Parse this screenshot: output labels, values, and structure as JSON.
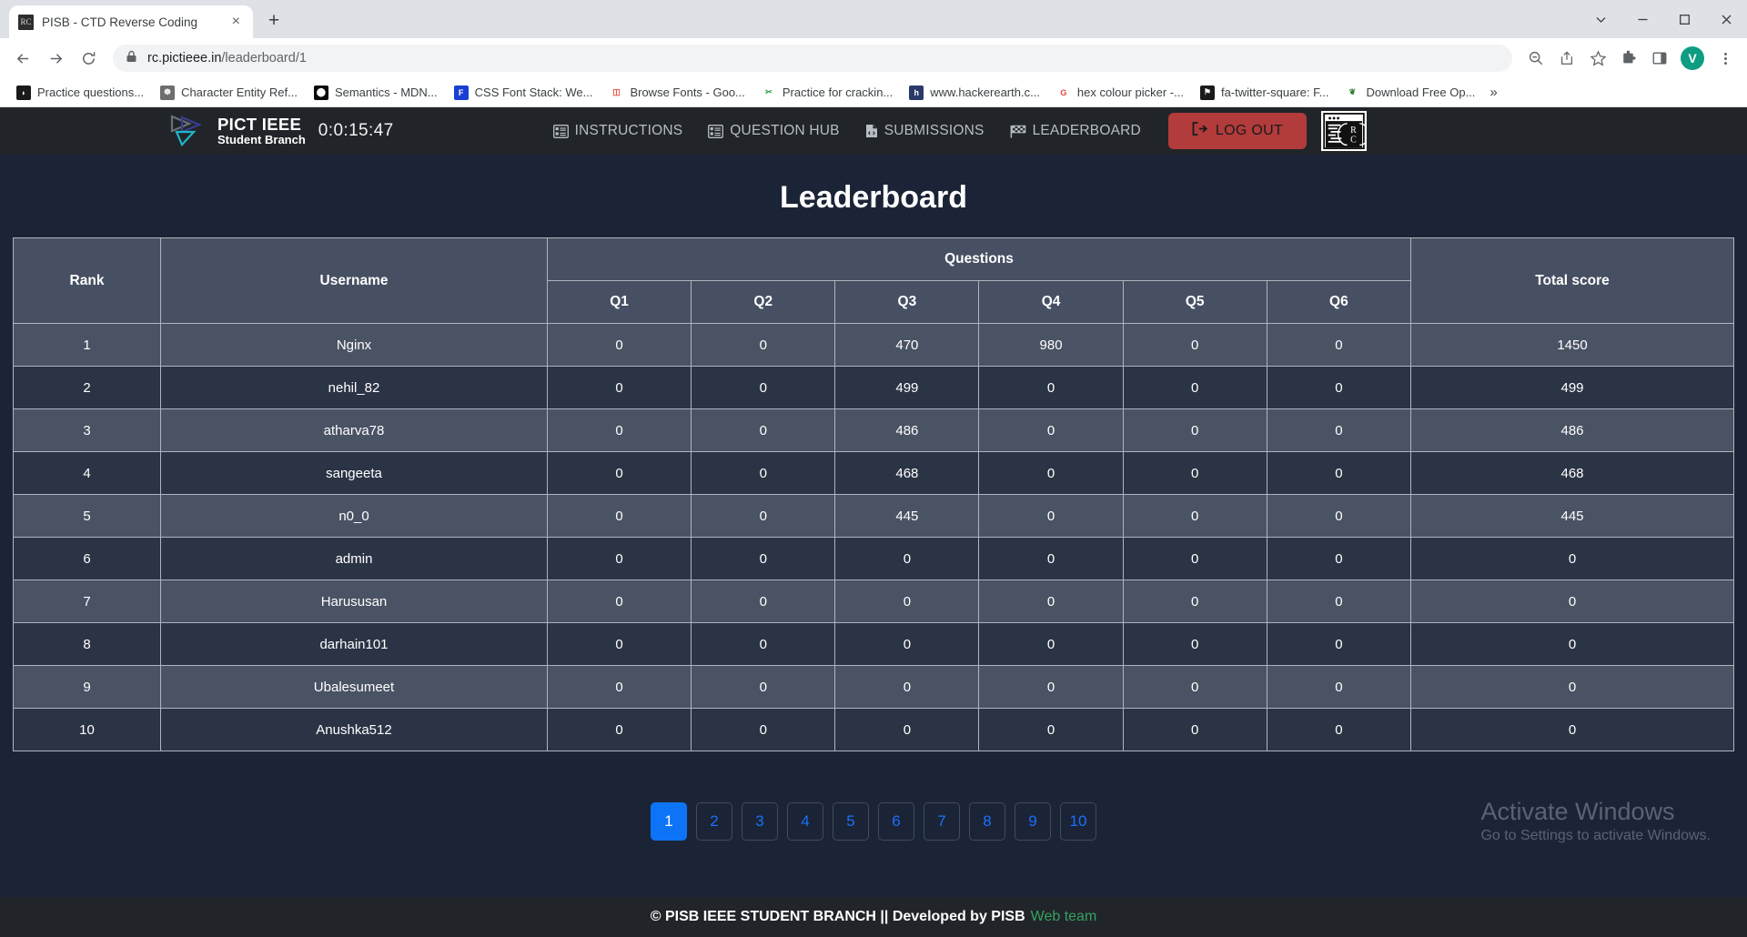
{
  "browser": {
    "tab": {
      "title": "PISB - CTD Reverse Coding",
      "favicon": "rc-favicon",
      "close_label": "×"
    },
    "new_tab_label": "+",
    "window_controls": {
      "minimize": "minimize-icon",
      "maximize": "maximize-icon",
      "close": "close-icon",
      "more": "chevron-down-icon"
    },
    "nav": {
      "back": "back-arrow-icon",
      "forward": "forward-arrow-icon",
      "reload": "reload-icon"
    },
    "omnibox": {
      "lock": "lock-icon",
      "domain": "rc.pictieee.in",
      "path": "/leaderboard/1"
    },
    "toolbar_icons": [
      "zoom-out-icon",
      "share-icon",
      "bookmark-star-icon",
      "extensions-icon",
      "side-panel-icon"
    ],
    "profile_initial": "V",
    "menu": "three-dot-menu-icon",
    "bookmarks": [
      {
        "label": "Practice questions...",
        "icon": "black-circle-play",
        "bg": "#1a1a1a",
        "fg": "#ffffff",
        "glyph": "◗"
      },
      {
        "label": "Character Entity Ref...",
        "icon": "globe-gray",
        "bg": "#6d6d6d",
        "fg": "#ffffff",
        "glyph": "☸"
      },
      {
        "label": "Semantics - MDN...",
        "icon": "mdn-black",
        "bg": "#0b0b0b",
        "fg": "#ffffff",
        "glyph": "⬤"
      },
      {
        "label": "CSS Font Stack: We...",
        "icon": "css-font-stack-blue",
        "bg": "#1a3fd4",
        "fg": "#ffffff",
        "glyph": "F"
      },
      {
        "label": "Browse Fonts - Goo...",
        "icon": "google-fonts",
        "bg": "#ffffff",
        "fg": "#ea4335",
        "glyph": "◫"
      },
      {
        "label": "Practice for crackin...",
        "icon": "green-scissors",
        "bg": "#ffffff",
        "fg": "#2e9b52",
        "glyph": "✂"
      },
      {
        "label": "www.hackerearth.c...",
        "icon": "hackerearth-h",
        "bg": "#2a3a68",
        "fg": "#ffffff",
        "glyph": "h"
      },
      {
        "label": "hex colour picker -...",
        "icon": "google-g",
        "bg": "#ffffff",
        "fg": "#ea4335",
        "glyph": "G"
      },
      {
        "label": "fa-twitter-square: F...",
        "icon": "font-awesome-flag",
        "bg": "#1a1a1a",
        "fg": "#ffffff",
        "glyph": "⚑"
      },
      {
        "label": "Download Free Op...",
        "icon": "green-leaf",
        "bg": "#ffffff",
        "fg": "#2e7d32",
        "glyph": "❦"
      }
    ],
    "bookmarks_overflow": "»"
  },
  "app": {
    "brand": {
      "line1": "PICT IEEE",
      "line2": "Student Branch",
      "logo": "pict-ieee-logo"
    },
    "timer": "0:0:15:47",
    "nav_links": [
      {
        "label": "INSTRUCTIONS",
        "icon": "list-alt-icon"
      },
      {
        "label": "QUESTION HUB",
        "icon": "list-alt-icon"
      },
      {
        "label": "SUBMISSIONS",
        "icon": "file-code-icon"
      },
      {
        "label": "LEADERBOARD",
        "icon": "checkered-flag-icon"
      }
    ],
    "logout": {
      "label": "LOG OUT",
      "icon": "sign-out-icon",
      "color": "#b23b3b"
    },
    "rc_logo": "reverse-coding-logo",
    "page_title": "Leaderboard"
  },
  "leaderboard": {
    "headers": {
      "rank": "Rank",
      "username": "Username",
      "questions": "Questions",
      "total": "Total score"
    },
    "question_columns": [
      "Q1",
      "Q2",
      "Q3",
      "Q4",
      "Q5",
      "Q6"
    ],
    "rows": [
      {
        "rank": "1",
        "username": "Nginx",
        "scores": [
          "0",
          "0",
          "470",
          "980",
          "0",
          "0"
        ],
        "total": "1450"
      },
      {
        "rank": "2",
        "username": "nehil_82",
        "scores": [
          "0",
          "0",
          "499",
          "0",
          "0",
          "0"
        ],
        "total": "499"
      },
      {
        "rank": "3",
        "username": "atharva78",
        "scores": [
          "0",
          "0",
          "486",
          "0",
          "0",
          "0"
        ],
        "total": "486"
      },
      {
        "rank": "4",
        "username": "sangeeta",
        "scores": [
          "0",
          "0",
          "468",
          "0",
          "0",
          "0"
        ],
        "total": "468"
      },
      {
        "rank": "5",
        "username": "n0_0",
        "scores": [
          "0",
          "0",
          "445",
          "0",
          "0",
          "0"
        ],
        "total": "445"
      },
      {
        "rank": "6",
        "username": "admin",
        "scores": [
          "0",
          "0",
          "0",
          "0",
          "0",
          "0"
        ],
        "total": "0"
      },
      {
        "rank": "7",
        "username": "Harususan",
        "scores": [
          "0",
          "0",
          "0",
          "0",
          "0",
          "0"
        ],
        "total": "0"
      },
      {
        "rank": "8",
        "username": "darhain101",
        "scores": [
          "0",
          "0",
          "0",
          "0",
          "0",
          "0"
        ],
        "total": "0"
      },
      {
        "rank": "9",
        "username": "Ubalesumeet",
        "scores": [
          "0",
          "0",
          "0",
          "0",
          "0",
          "0"
        ],
        "total": "0"
      },
      {
        "rank": "10",
        "username": "Anushka512",
        "scores": [
          "0",
          "0",
          "0",
          "0",
          "0",
          "0"
        ],
        "total": "0"
      }
    ]
  },
  "pagination": {
    "pages": [
      "1",
      "2",
      "3",
      "4",
      "5",
      "6",
      "7",
      "8",
      "9",
      "10"
    ],
    "active": "1",
    "active_color": "#0d74f7",
    "link_color": "#1a6ffb"
  },
  "watermark": {
    "line1": "Activate Windows",
    "line2": "Go to Settings to activate Windows."
  },
  "footer": {
    "text": "© PISB IEEE STUDENT BRANCH || Developed by PISB",
    "link": "Web team",
    "link_color": "#35a160"
  }
}
